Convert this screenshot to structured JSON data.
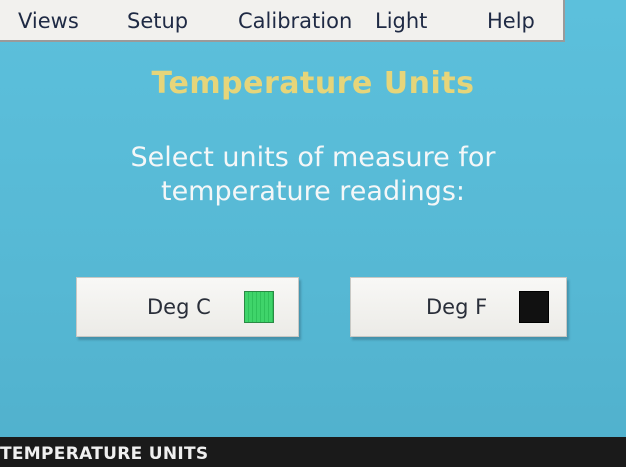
{
  "menu": {
    "views": "Views",
    "setup": "Setup",
    "calibration": "Calibration",
    "light": "Light",
    "help": "Help"
  },
  "screen": {
    "title": "Temperature Units",
    "instructions": "Select units of measure for temperature readings:"
  },
  "units": {
    "celsius": {
      "label": "Deg C",
      "selected": true,
      "indicator_color": "#3fd46a"
    },
    "fahrenheit": {
      "label": "Deg F",
      "selected": false,
      "indicator_color": "#111111"
    }
  },
  "status_bar": {
    "text": "TEMPERATURE UNITS"
  },
  "colors": {
    "background": "#5bbcd8",
    "title": "#e6d57a",
    "instruction_text": "#f4f7f8",
    "status_bar": "#1a1a1a"
  }
}
